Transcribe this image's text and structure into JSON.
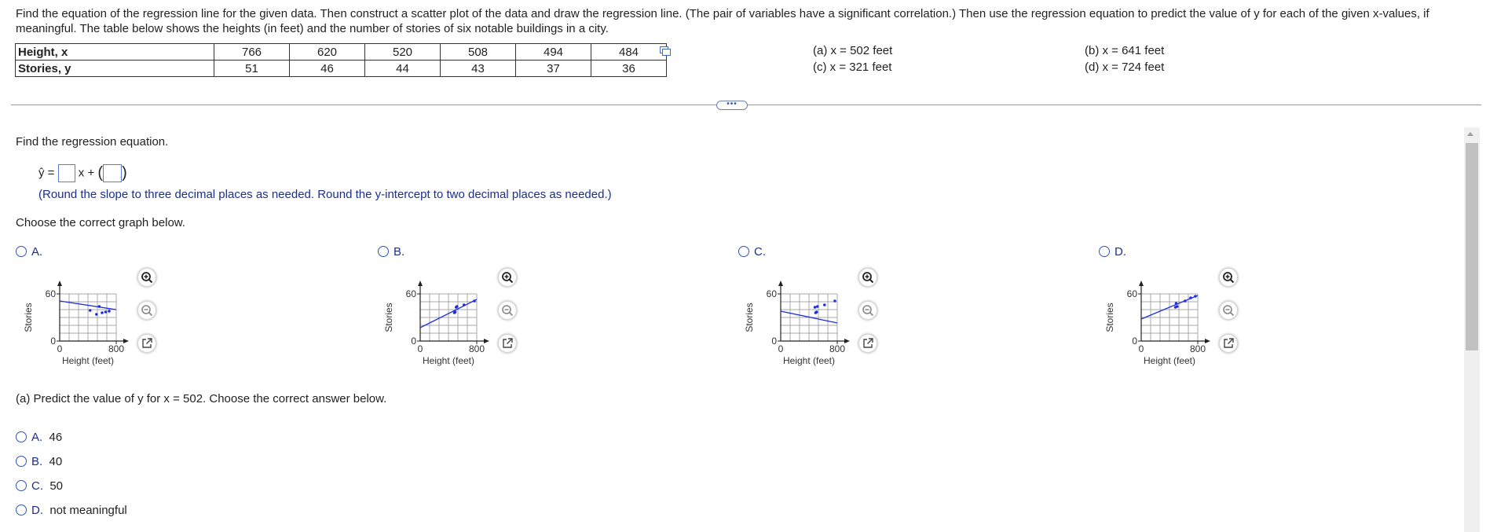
{
  "problem": {
    "text": "Find the equation of the regression line for the given data. Then construct a scatter plot of the data and draw the regression line. (The pair of variables have a significant correlation.) Then use the regression equation to predict the value of y for each of the given x-values, if meaningful. The table below shows the heights (in feet) and the number of stories of six notable buildings in a city."
  },
  "table": {
    "x_label": "Height, x",
    "y_label": "Stories, y",
    "x_values": [
      "766",
      "620",
      "520",
      "508",
      "494",
      "484"
    ],
    "y_values": [
      "51",
      "46",
      "44",
      "43",
      "37",
      "36"
    ]
  },
  "x_values_to_predict": {
    "a": "(a) x = 502 feet",
    "b": "(b) x = 641 feet",
    "c": "(c) x = 321 feet",
    "d": "(d) x = 724 feet"
  },
  "more_button_label": "•••",
  "regression": {
    "prompt": "Find the regression equation.",
    "yhat_prefix": "ŷ =",
    "x_plus": "x +",
    "round_note": "(Round the slope to three decimal places as needed. Round the y-intercept to two decimal places as needed.)"
  },
  "graph_question": "Choose the correct graph below.",
  "graphs": [
    {
      "letter": "A.",
      "y_axis_label": "Stories",
      "x_axis_label": "Height (feet)",
      "y_tick_top": "60",
      "y_tick_bottom": "0",
      "x_tick_left": "0",
      "x_tick_right": "800",
      "points": [
        [
          430,
          39
        ],
        [
          520,
          34
        ],
        [
          560,
          44
        ],
        [
          600,
          36
        ],
        [
          650,
          37
        ],
        [
          700,
          38
        ]
      ],
      "line": [
        [
          0,
          51
        ],
        [
          800,
          40
        ]
      ]
    },
    {
      "letter": "B.",
      "y_axis_label": "Stories",
      "x_axis_label": "Height (feet)",
      "y_tick_top": "60",
      "y_tick_bottom": "0",
      "x_tick_left": "0",
      "x_tick_right": "800",
      "points": [
        [
          484,
          36
        ],
        [
          494,
          37
        ],
        [
          508,
          43
        ],
        [
          520,
          44
        ],
        [
          620,
          46
        ],
        [
          766,
          51
        ]
      ],
      "line": [
        [
          0,
          17
        ],
        [
          800,
          53
        ]
      ]
    },
    {
      "letter": "C.",
      "y_axis_label": "Stories",
      "x_axis_label": "Height (feet)",
      "y_tick_top": "60",
      "y_tick_bottom": "0",
      "x_tick_left": "0",
      "x_tick_right": "800",
      "points": [
        [
          484,
          43
        ],
        [
          494,
          36
        ],
        [
          508,
          37
        ],
        [
          520,
          44
        ],
        [
          620,
          46
        ],
        [
          766,
          51
        ]
      ],
      "line": [
        [
          0,
          38
        ],
        [
          800,
          23
        ]
      ]
    },
    {
      "letter": "D.",
      "y_axis_label": "Stories",
      "x_axis_label": "Height (feet)",
      "y_tick_top": "60",
      "y_tick_bottom": "0",
      "x_tick_left": "0",
      "x_tick_right": "800",
      "points": [
        [
          484,
          43
        ],
        [
          494,
          48
        ],
        [
          508,
          44
        ],
        [
          620,
          51
        ],
        [
          700,
          55
        ],
        [
          766,
          57
        ]
      ],
      "line": [
        [
          0,
          28
        ],
        [
          800,
          58
        ]
      ]
    }
  ],
  "predict_a": {
    "question": "(a) Predict the value of y for x = 502. Choose the correct answer below.",
    "options": [
      {
        "letter": "A.",
        "text": "46"
      },
      {
        "letter": "B.",
        "text": "40"
      },
      {
        "letter": "C.",
        "text": "50"
      },
      {
        "letter": "D.",
        "text": "not meaningful"
      }
    ]
  },
  "colors": {
    "accent": "#1a2f8f",
    "plot_blue": "#1f2fe0",
    "grid": "#9a9a9a"
  }
}
